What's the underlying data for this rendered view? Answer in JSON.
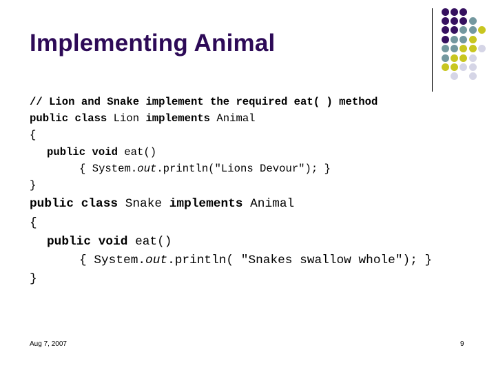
{
  "slide": {
    "title": "Implementing Animal",
    "colors": {
      "title": "#2d0a57",
      "purple": "#35105f",
      "teal": "#73989f",
      "yellow": "#c8c620",
      "lavender": "#d5d5e6"
    },
    "decoration_dots": [
      [
        "purple",
        "purple",
        "purple",
        null,
        null
      ],
      [
        "purple",
        "purple",
        "purple",
        "teal",
        null
      ],
      [
        "purple",
        "purple",
        "teal",
        "teal",
        "yellow"
      ],
      [
        "purple",
        "teal",
        "teal",
        "yellow",
        null
      ],
      [
        "teal",
        "teal",
        "yellow",
        "yellow",
        "lavender"
      ],
      [
        "teal",
        "yellow",
        "yellow",
        "lavender",
        null
      ],
      [
        "yellow",
        "yellow",
        "lavender",
        "lavender",
        null
      ],
      [
        null,
        "lavender",
        null,
        "lavender",
        null
      ]
    ],
    "code": {
      "lion": {
        "comment": "// Lion and Snake implement the required eat( ) method",
        "kw_public_class": "public class",
        "class_name": "Lion",
        "kw_implements": "implements",
        "interface_name": "Animal",
        "open_brace": "{",
        "method_kw": "public void",
        "method_sig": "eat()",
        "body_open": "{ System.",
        "body_out": "out",
        "body_rest": ".println(\"Lions Devour\"); }",
        "close_brace": "}"
      },
      "snake": {
        "kw_public_class": "public class",
        "class_name": "Snake",
        "kw_implements": "implements",
        "interface_name": "Animal",
        "open_brace": "{",
        "method_kw": "public void",
        "method_sig": "eat()",
        "body_open": "{ System.",
        "body_out": "out",
        "body_rest": ".println( \"Snakes swallow whole\"); }",
        "close_brace": "}"
      }
    },
    "footer": {
      "date": "Aug 7, 2007",
      "page_number": "9"
    }
  }
}
